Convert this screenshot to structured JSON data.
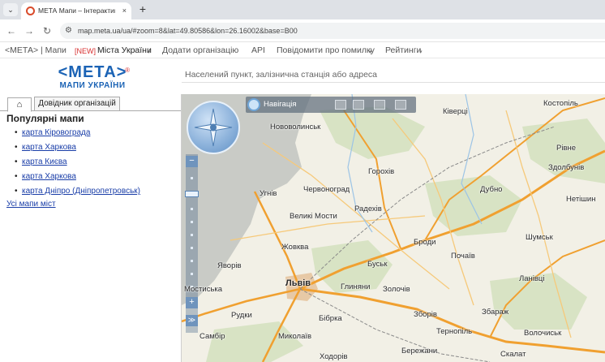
{
  "browser": {
    "menu_glyph": "⌄",
    "tab_title": "МЕТА Мапи – Інтерактивна ка",
    "tab_close": "×",
    "new_tab": "+",
    "back_glyph": "←",
    "forward_glyph": "→",
    "reload_glyph": "↻",
    "site_info_glyph": "⚙",
    "url": "map.meta.ua/ua/#zoom=8&lat=49.80586&lon=26.16002&base=B00"
  },
  "site_nav": {
    "items": [
      {
        "label": "<МЕТА> | Мапи"
      },
      {
        "label": "[NEW]",
        "tag": true
      },
      {
        "label": "Міста України"
      },
      {
        "label": "Додати організацію"
      },
      {
        "label": "API"
      },
      {
        "label": "Повідомити про помилку"
      },
      {
        "label": "Рейтинги"
      }
    ],
    "caret": "▾"
  },
  "header": {
    "logo_main": "<МЕТА>",
    "logo_sub": "МАПИ УКРАЇНИ",
    "logo_reg": "®",
    "search_placeholder": "Населений пункт, залізнична станція або адреса"
  },
  "sidebar": {
    "home_tab_glyph": "⌂",
    "directory_tab": "Довідник організацій",
    "title": "Популярні мапи",
    "links": [
      "карта Кіровограда",
      "карта Харкова",
      "карта Києва",
      "карта Харкова",
      "карта Дніпро (Дніпропетровськ)"
    ],
    "all_maps": "Усі мапи міст"
  },
  "map": {
    "navigation_label": "Навігація",
    "zoom_in": "−",
    "zoom_out": "+",
    "cities": [
      "Ківерці",
      "Костопіль",
      "Нововолинськ",
      "Рівне",
      "Здолбунів",
      "Горохів",
      "Угнів",
      "Червоноград",
      "Дубно",
      "Нетішин",
      "Радехів",
      "Великі Мости",
      "Шумськ",
      "Жовква",
      "Броди",
      "Почаїв",
      "Яворів",
      "Буськ",
      "Ланівці",
      "Мостиська",
      "Львів",
      "Глиняни",
      "Золочів",
      "Рудки",
      "Бібрка",
      "Зборів",
      "Збараж",
      "Самбір",
      "Миколаїв",
      "Тернопіль",
      "Волочиськ",
      "Ходорів",
      "Бережани",
      "Скалат"
    ]
  }
}
